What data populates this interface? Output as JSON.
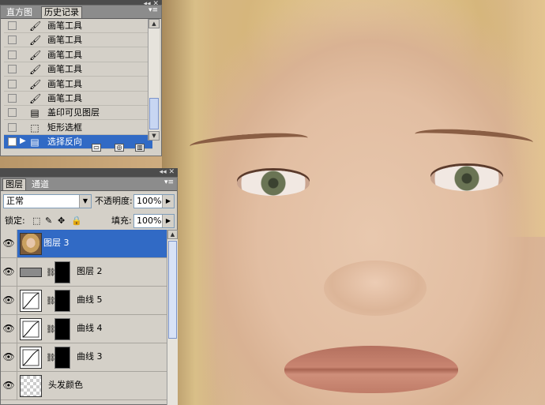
{
  "history_panel": {
    "tabs": [
      "直方图",
      "历史记录"
    ],
    "items": [
      {
        "label": "画笔工具",
        "icon": "brush-icon",
        "selected": false
      },
      {
        "label": "画笔工具",
        "icon": "brush-icon",
        "selected": false
      },
      {
        "label": "画笔工具",
        "icon": "brush-icon",
        "selected": false
      },
      {
        "label": "画笔工具",
        "icon": "brush-icon",
        "selected": false
      },
      {
        "label": "画笔工具",
        "icon": "brush-icon",
        "selected": false
      },
      {
        "label": "画笔工具",
        "icon": "brush-icon",
        "selected": false
      },
      {
        "label": "盖印可见图层",
        "icon": "stamp-layer-icon",
        "selected": false
      },
      {
        "label": "矩形选框",
        "icon": "marquee-icon",
        "selected": false
      },
      {
        "label": "选择反向",
        "icon": "invert-selection-icon",
        "selected": true
      }
    ],
    "footer_icons": [
      "new-document-icon",
      "snapshot-icon",
      "trash-icon"
    ]
  },
  "layers_panel": {
    "tabs": [
      "图层",
      "通道"
    ],
    "blend_mode": "正常",
    "opacity_label": "不透明度:",
    "opacity_value": "100%",
    "lock_label": "锁定:",
    "fill_label": "填充:",
    "fill_value": "100%",
    "layers": [
      {
        "name": "图层 3",
        "type": "photo",
        "selected": true
      },
      {
        "name": "图层 2",
        "type": "gray-with-mask",
        "selected": false
      },
      {
        "name": "曲线 5",
        "type": "curves",
        "selected": false
      },
      {
        "name": "曲线 4",
        "type": "curves",
        "selected": false
      },
      {
        "name": "曲线 3",
        "type": "curves",
        "selected": false
      },
      {
        "name": "头发颜色",
        "type": "transparent",
        "selected": false
      }
    ]
  },
  "colors": {
    "selection": "#316ac5",
    "panel_bg": "#d4d0c8",
    "tab_bar": "#8c8c8c"
  }
}
